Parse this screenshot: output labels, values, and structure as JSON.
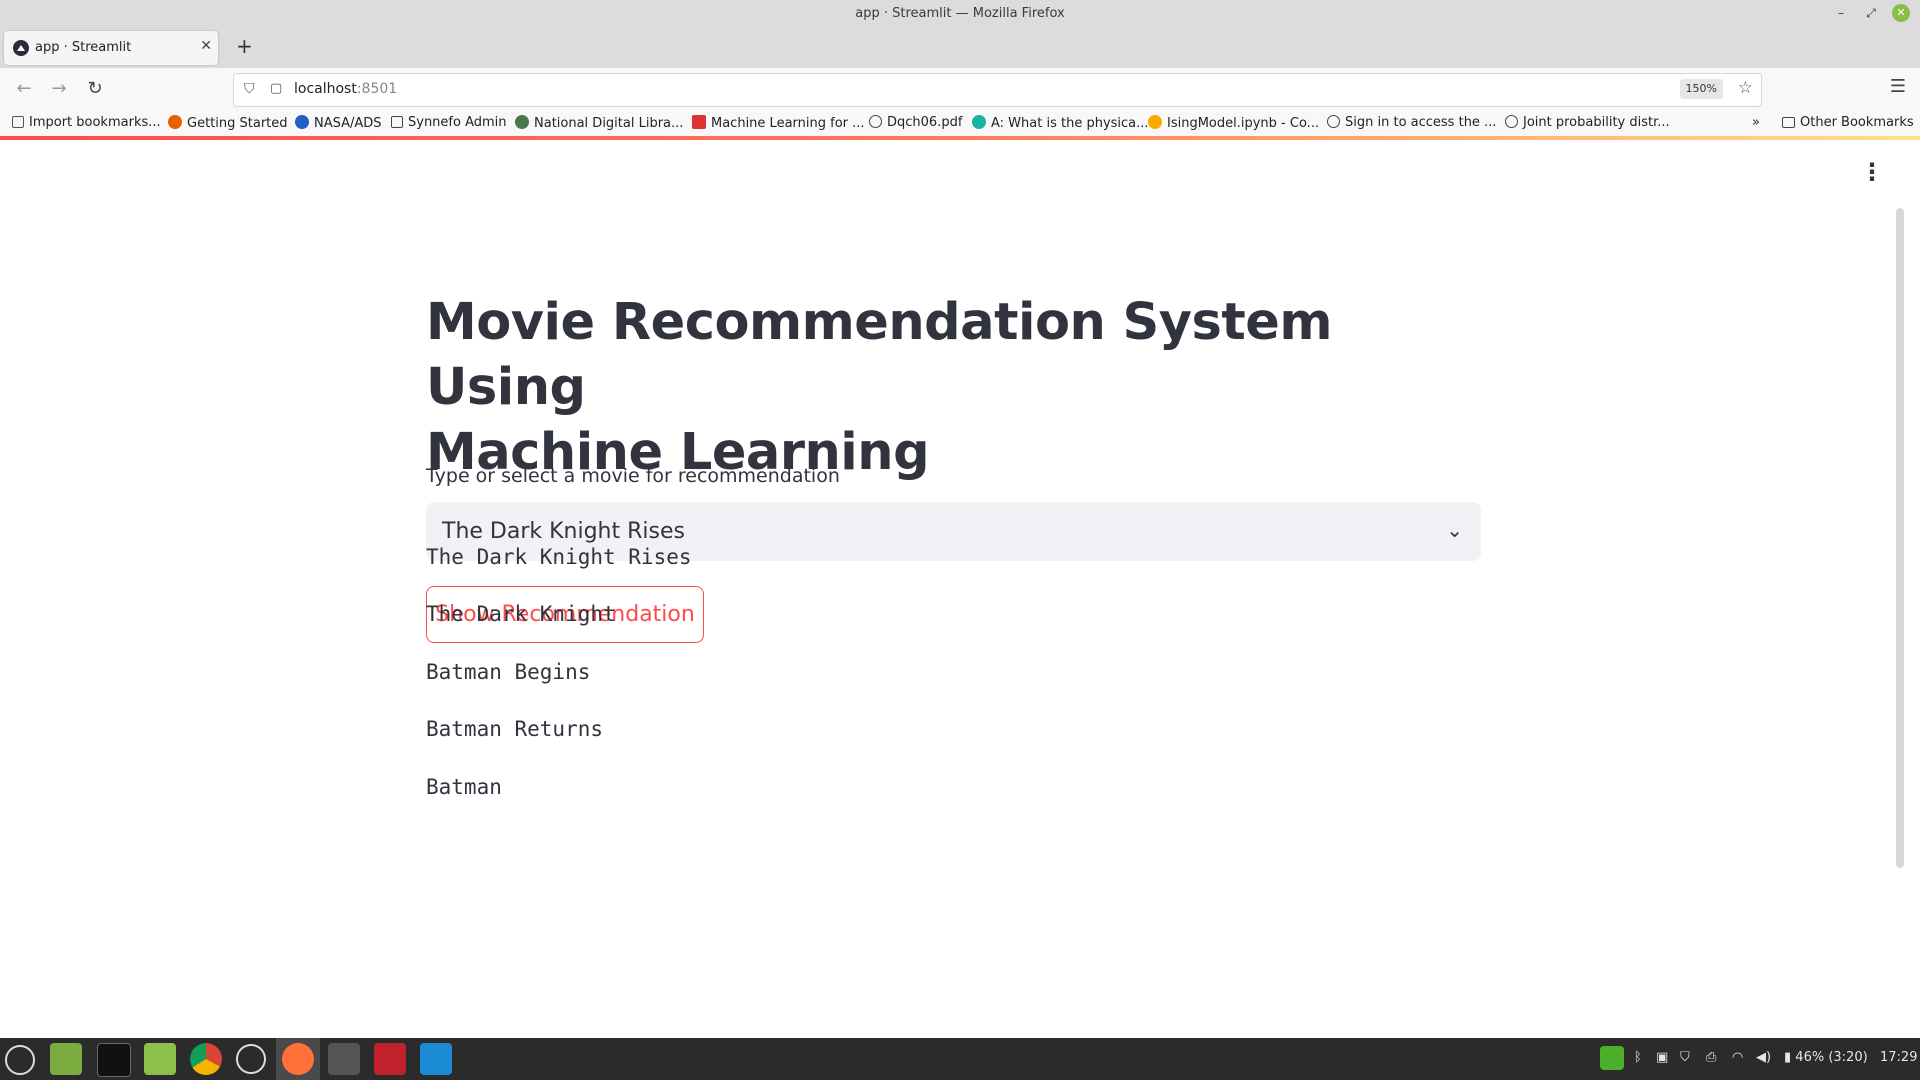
{
  "window": {
    "title": "app · Streamlit — Mozilla Firefox"
  },
  "tab": {
    "title": "app · Streamlit",
    "new_tab": "+"
  },
  "nav": {
    "url_host": "localhost",
    "url_port": ":8501",
    "zoom": "150%"
  },
  "bookmarks": [
    "Import bookmarks...",
    "Getting Started",
    "NASA/ADS",
    "Synnefo Admin",
    "National Digital Libra...",
    "Machine Learning for ...",
    "Dqch06.pdf",
    "A: What is the physica...",
    "IsingModel.ipynb - Co...",
    "Sign in to access the ...",
    "Joint probability distr...",
    "Other Bookmarks"
  ],
  "main": {
    "title_line1": "Movie Recommendation System Using",
    "title_line2": "Machine Learning",
    "select_label": "Type or select a movie for recommendation",
    "select_value": "The Dark Knight Rises",
    "button_label": "Show Recommendation",
    "results": [
      "The Dark Knight Rises",
      "The Dark Knight",
      "Batman Begins",
      "Batman Returns",
      "Batman"
    ]
  },
  "taskbar": {
    "battery": "46% (3:20)",
    "clock": "17:29"
  },
  "colors": {
    "accent": "#ff4b4b",
    "text": "#31333f",
    "select_bg": "#f0f2f6"
  }
}
